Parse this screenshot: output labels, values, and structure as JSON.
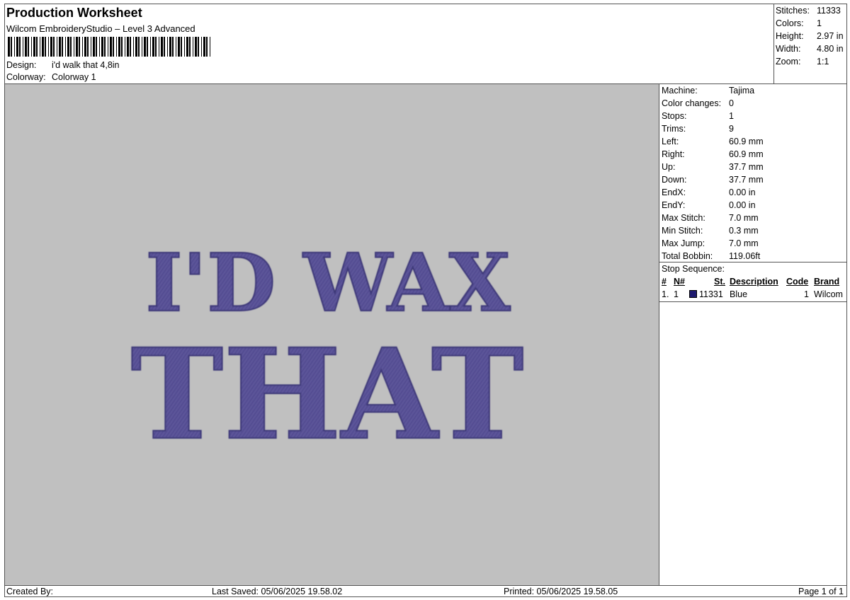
{
  "header": {
    "title": "Production Worksheet",
    "subtitle": "Wilcom EmbroideryStudio – Level 3 Advanced",
    "design_label": "Design:",
    "design_value": "i'd walk that 4,8in",
    "colorway_label": "Colorway:",
    "colorway_value": "Colorway 1"
  },
  "summary": {
    "stitches_label": "Stitches:",
    "stitches_value": "11333",
    "colors_label": "Colors:",
    "colors_value": "1",
    "height_label": "Height:",
    "height_value": "2.97 in",
    "width_label": "Width:",
    "width_value": "4.80 in",
    "zoom_label": "Zoom:",
    "zoom_value": "1:1"
  },
  "design_text": {
    "line1": "I'D WAX",
    "line2": "THAT",
    "thread_color": "#5b5499"
  },
  "details": [
    {
      "label": "Machine:",
      "value": "Tajima"
    },
    {
      "label": "Color changes:",
      "value": "0"
    },
    {
      "label": "Stops:",
      "value": "1"
    },
    {
      "label": "Trims:",
      "value": "9"
    },
    {
      "label": "Left:",
      "value": "60.9 mm"
    },
    {
      "label": "Right:",
      "value": "60.9 mm"
    },
    {
      "label": "Up:",
      "value": "37.7 mm"
    },
    {
      "label": "Down:",
      "value": "37.7 mm"
    },
    {
      "label": "EndX:",
      "value": "0.00 in"
    },
    {
      "label": "EndY:",
      "value": "0.00 in"
    },
    {
      "label": "Max Stitch:",
      "value": "7.0 mm"
    },
    {
      "label": "Min Stitch:",
      "value": "0.3 mm"
    },
    {
      "label": "Max Jump:",
      "value": "7.0 mm"
    },
    {
      "label": "Total Bobbin:",
      "value": "119.06ft"
    }
  ],
  "stop_sequence": {
    "title": "Stop Sequence:",
    "headers": {
      "num": "#",
      "n": "N#",
      "st": "St.",
      "description": "Description",
      "code": "Code",
      "brand": "Brand"
    },
    "rows": [
      {
        "num": "1.",
        "n": "1",
        "st": "11331",
        "description": "Blue",
        "code": "1",
        "brand": "Wilcom",
        "color": "#1e1a6e"
      }
    ]
  },
  "footer": {
    "created_by": "Created By:",
    "last_saved": "Last Saved: 05/06/2025 19.58.02",
    "printed": "Printed: 05/06/2025 19.58.05",
    "page": "Page 1 of 1"
  }
}
